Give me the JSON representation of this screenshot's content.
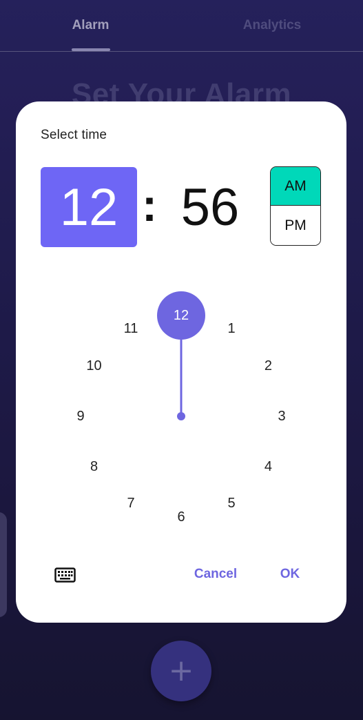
{
  "tabs": [
    {
      "label": "Alarm",
      "selected": true
    },
    {
      "label": "Analytics",
      "selected": false
    }
  ],
  "background": {
    "heading": "Set Your Alarm",
    "fab_icon": "plus-icon",
    "fab_symbol": "+"
  },
  "dialog": {
    "title": "Select time",
    "hour": "12",
    "separator": ":",
    "minute": "56",
    "am_label": "AM",
    "pm_label": "PM",
    "period_selected": "AM",
    "dial": {
      "numbers": [
        "12",
        "1",
        "2",
        "3",
        "4",
        "5",
        "6",
        "7",
        "8",
        "9",
        "10",
        "11"
      ],
      "selected": "12"
    },
    "keyboard_icon": "keyboard-icon",
    "cancel_label": "Cancel",
    "ok_label": "OK"
  },
  "colors": {
    "accent": "#6e66f5",
    "am_highlight": "#00d8b9",
    "action_text": "#6e66e0",
    "background_top": "#2b2668",
    "background_bottom": "#1a1738"
  }
}
